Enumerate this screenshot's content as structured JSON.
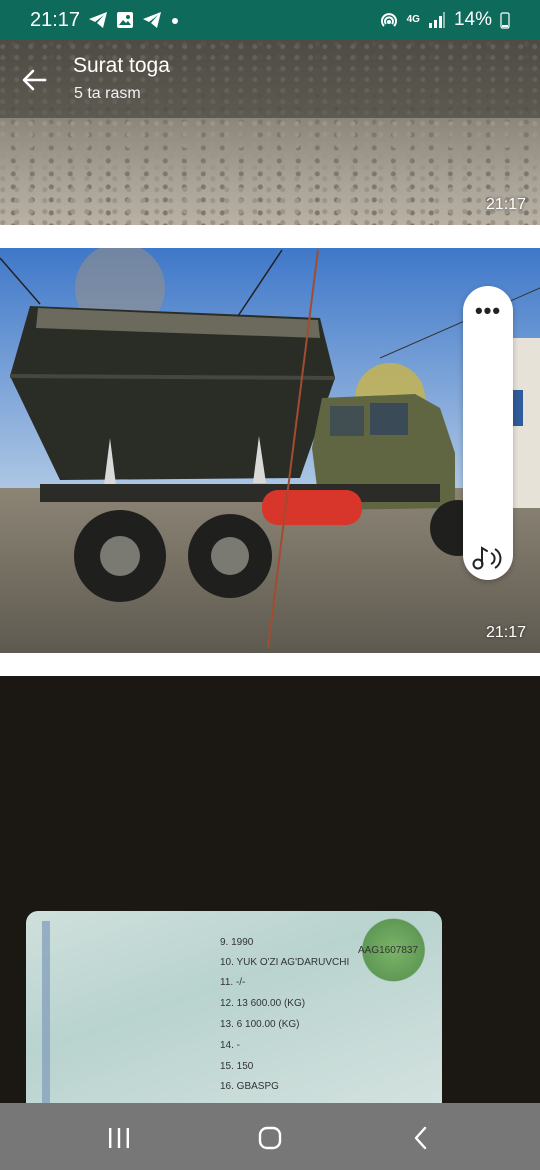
{
  "status_bar": {
    "time": "21:17",
    "notification_icons": [
      "telegram-icon",
      "gallery-icon",
      "telegram-icon",
      "dot-icon"
    ],
    "right_icons": [
      "hotspot-icon",
      "4g-icon",
      "signal-icon"
    ],
    "network": "4G",
    "battery": "14%"
  },
  "header": {
    "title": "Surat toga",
    "subtitle": "5 ta rasm"
  },
  "photos": [
    {
      "description": "gravel",
      "time": "21:17"
    },
    {
      "description": "dump truck",
      "time": "21:17"
    },
    {
      "description": "vehicle registration document",
      "time": ""
    }
  ],
  "document": {
    "serial": "AAG1607837",
    "rows": [
      "9. 1990",
      "10. YUK O'ZI AG'DARUVCHI",
      "11. -/-",
      "12. 13 600.00 (KG)",
      "13. 6 100.00 (KG)",
      "14. -",
      "15. 150",
      "16. GBASPG"
    ]
  },
  "nav": {
    "buttons": [
      "recents",
      "home",
      "back"
    ]
  }
}
